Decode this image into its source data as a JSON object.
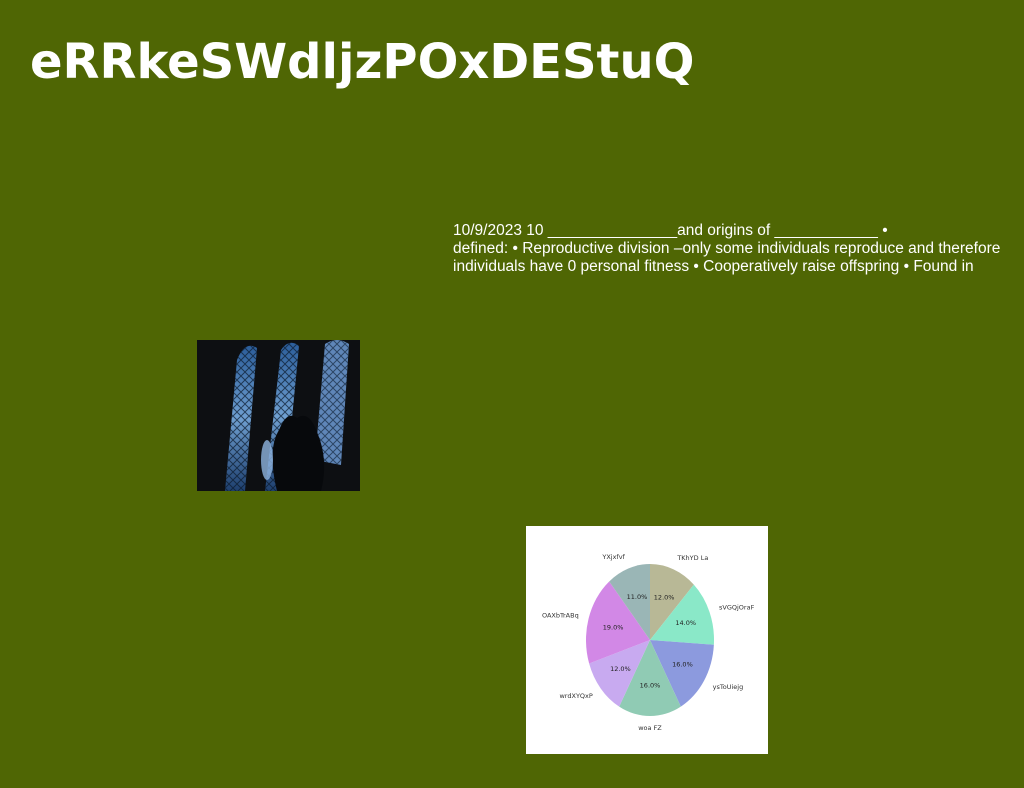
{
  "page": {
    "title": "eRRkeSWdljzPOxDEStuQ",
    "background": "#4f6604"
  },
  "text_block": {
    "lines": [
      "10/9/2023 10 _______________and origins of ____________ •",
      "defined: • Reproductive division –only some individuals reproduce and therefore",
      "individuals have 0 personal fitness • Cooperatively raise offspring • Found in"
    ]
  },
  "photo": {
    "subject": "dark figure behind blue stained glass window strips"
  },
  "chart_data": {
    "type": "pie",
    "title": "",
    "slices": [
      {
        "label": "TKhYD La",
        "value": 12.0,
        "color": "#b8b896"
      },
      {
        "label": "sVGQjOraF",
        "value": 14.0,
        "color": "#8ae8c8"
      },
      {
        "label": "ysToUiejg",
        "value": 16.0,
        "color": "#8c9ade"
      },
      {
        "label": "woa FZ",
        "value": 16.0,
        "color": "#90cbb4"
      },
      {
        "label": "wrdXYQxP",
        "value": 12.0,
        "color": "#c8aaf0"
      },
      {
        "label": "OAXbTrABq",
        "value": 19.0,
        "color": "#d288e6"
      },
      {
        "label": "YXjxfvf",
        "value": 11.0,
        "color": "#9ab6b6"
      }
    ]
  }
}
